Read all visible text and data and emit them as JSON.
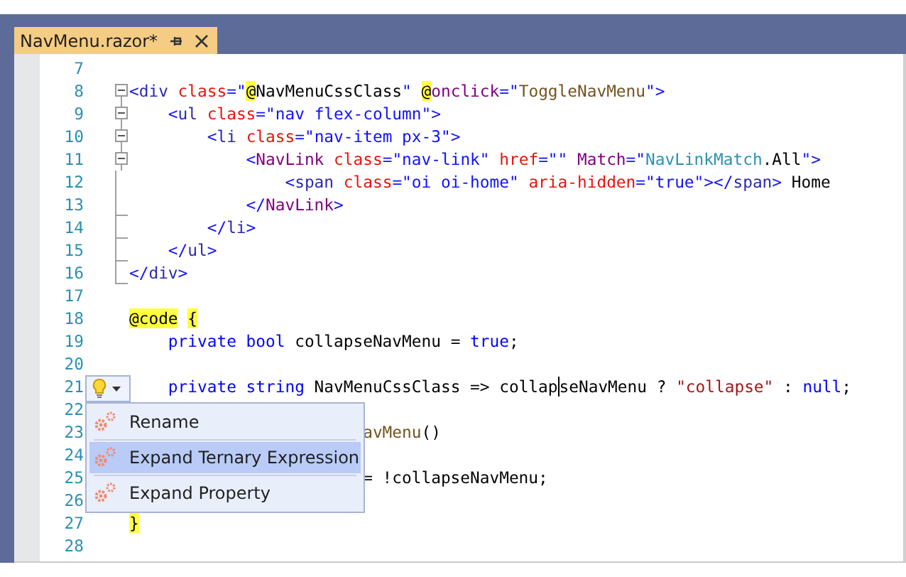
{
  "tab": {
    "title": "NavMenu.razor*",
    "selected": true
  },
  "lines": [
    {
      "number": "7",
      "collapsible": false,
      "block_end": false
    },
    {
      "number": "8",
      "collapsible": true,
      "block_end": false,
      "tokens": [
        {
          "kind": "delim",
          "text": "<"
        },
        {
          "kind": "tag",
          "text": "div "
        },
        {
          "kind": "attr",
          "text": "class"
        },
        {
          "kind": "delim",
          "text": "=\""
        },
        {
          "kind": "razor",
          "text": "@"
        },
        {
          "kind": "plain",
          "text": "NavMenuCssClass"
        },
        {
          "kind": "delim",
          "text": "\" "
        },
        {
          "kind": "razor",
          "text": "@"
        },
        {
          "kind": "component",
          "text": "onclick"
        },
        {
          "kind": "delim",
          "text": "=\""
        },
        {
          "kind": "method",
          "text": "ToggleNavMenu"
        },
        {
          "kind": "delim",
          "text": "\">"
        }
      ]
    },
    {
      "number": "9",
      "collapsible": true,
      "block_end": false,
      "tokens": [
        {
          "kind": "delim",
          "text": "    <"
        },
        {
          "kind": "tag",
          "text": "ul "
        },
        {
          "kind": "attr",
          "text": "class"
        },
        {
          "kind": "delim",
          "text": "="
        },
        {
          "kind": "value",
          "text": "\"nav flex-column\""
        },
        {
          "kind": "delim",
          "text": ">"
        }
      ]
    },
    {
      "number": "10",
      "collapsible": true,
      "block_end": false,
      "tokens": [
        {
          "kind": "delim",
          "text": "        <"
        },
        {
          "kind": "tag",
          "text": "li "
        },
        {
          "kind": "attr",
          "text": "class"
        },
        {
          "kind": "delim",
          "text": "="
        },
        {
          "kind": "value",
          "text": "\"nav-item px-3\""
        },
        {
          "kind": "delim",
          "text": ">"
        }
      ]
    },
    {
      "number": "11",
      "collapsible": true,
      "block_end": false,
      "tokens": [
        {
          "kind": "delim",
          "text": "            <"
        },
        {
          "kind": "component",
          "text": "NavLink "
        },
        {
          "kind": "attr",
          "text": "class"
        },
        {
          "kind": "delim",
          "text": "="
        },
        {
          "kind": "value",
          "text": "\"nav-link\" "
        },
        {
          "kind": "attr",
          "text": "href"
        },
        {
          "kind": "delim",
          "text": "="
        },
        {
          "kind": "value",
          "text": "\"\" "
        },
        {
          "kind": "component",
          "text": "Match"
        },
        {
          "kind": "delim",
          "text": "="
        },
        {
          "kind": "value",
          "text": "\""
        },
        {
          "kind": "type",
          "text": "NavLinkMatch"
        },
        {
          "kind": "plain",
          "text": ".All"
        },
        {
          "kind": "value",
          "text": "\""
        },
        {
          "kind": "delim",
          "text": ">"
        }
      ]
    },
    {
      "number": "12",
      "collapsible": false,
      "block_end": false,
      "tokens": [
        {
          "kind": "delim",
          "text": "                <"
        },
        {
          "kind": "tag",
          "text": "span "
        },
        {
          "kind": "attr",
          "text": "class"
        },
        {
          "kind": "delim",
          "text": "="
        },
        {
          "kind": "value",
          "text": "\"oi oi-home\" "
        },
        {
          "kind": "attr",
          "text": "aria-hidden"
        },
        {
          "kind": "delim",
          "text": "="
        },
        {
          "kind": "value",
          "text": "\"true\""
        },
        {
          "kind": "delim",
          "text": "></"
        },
        {
          "kind": "tag",
          "text": "span"
        },
        {
          "kind": "delim",
          "text": ">"
        },
        {
          "kind": "plain",
          "text": " Home"
        }
      ]
    },
    {
      "number": "13",
      "collapsible": false,
      "block_end": true,
      "tokens": [
        {
          "kind": "delim",
          "text": "            </"
        },
        {
          "kind": "component",
          "text": "NavLink"
        },
        {
          "kind": "delim",
          "text": ">"
        }
      ]
    },
    {
      "number": "14",
      "collapsible": false,
      "block_end": true,
      "tokens": [
        {
          "kind": "delim",
          "text": "        </"
        },
        {
          "kind": "tag",
          "text": "li"
        },
        {
          "kind": "delim",
          "text": ">"
        }
      ]
    },
    {
      "number": "15",
      "collapsible": false,
      "block_end": true,
      "tokens": [
        {
          "kind": "delim",
          "text": "    </"
        },
        {
          "kind": "tag",
          "text": "ul"
        },
        {
          "kind": "delim",
          "text": ">"
        }
      ]
    },
    {
      "number": "16",
      "collapsible": false,
      "block_end": true,
      "tokens": [
        {
          "kind": "delim",
          "text": "</"
        },
        {
          "kind": "tag",
          "text": "div"
        },
        {
          "kind": "delim",
          "text": ">"
        }
      ]
    },
    {
      "number": "17",
      "collapsible": false,
      "block_end": false
    },
    {
      "number": "18",
      "collapsible": false,
      "block_end": false,
      "tokens": [
        {
          "kind": "razor",
          "text": "@code"
        },
        {
          "kind": "razor",
          "text": "{"
        }
      ]
    },
    {
      "number": "19",
      "collapsible": false,
      "block_end": false,
      "tokens": [
        {
          "kind": "keyword",
          "text": "    private bool"
        },
        {
          "kind": "plain",
          "text": " collapseNavMenu = "
        },
        {
          "kind": "keyword",
          "text": "true"
        },
        {
          "kind": "plain",
          "text": ";"
        }
      ]
    },
    {
      "number": "20",
      "collapsible": false,
      "block_end": false
    },
    {
      "number": "21",
      "collapsible": false,
      "block_end": false,
      "tokens": [
        {
          "kind": "keyword",
          "text": "    private string"
        },
        {
          "kind": "plain",
          "text": " NavMenuCssClass => collap"
        },
        {
          "kind": "caret"
        },
        {
          "kind": "plain",
          "text": "seNavMenu ? "
        },
        {
          "kind": "string",
          "text": "\"collapse\""
        },
        {
          "kind": "plain",
          "text": " : "
        },
        {
          "kind": "keyword",
          "text": "null"
        },
        {
          "kind": "plain",
          "text": ";"
        }
      ]
    },
    {
      "number": "22",
      "collapsible": false,
      "block_end": false
    },
    {
      "number": "23",
      "collapsible": false,
      "block_end": false,
      "tokens": [
        {
          "kind": "method",
          "text": "                        avMenu"
        },
        {
          "kind": "plain",
          "text": "()"
        }
      ]
    },
    {
      "number": "24",
      "collapsible": false,
      "block_end": false
    },
    {
      "number": "25",
      "collapsible": false,
      "block_end": false,
      "tokens": [
        {
          "kind": "plain",
          "text": "                        = !collapseNavMenu;"
        }
      ]
    },
    {
      "number": "26",
      "collapsible": false,
      "block_end": false
    },
    {
      "number": "27",
      "collapsible": false,
      "block_end": false,
      "tokens": [
        {
          "kind": "razor",
          "text": "}"
        }
      ]
    },
    {
      "number": "28",
      "collapsible": false,
      "block_end": false
    }
  ],
  "quick_actions": {
    "menu": [
      {
        "label": "Rename",
        "selected": false
      },
      {
        "label": "Expand Ternary Expression",
        "selected": true
      },
      {
        "label": "Expand Property",
        "selected": false
      }
    ]
  }
}
